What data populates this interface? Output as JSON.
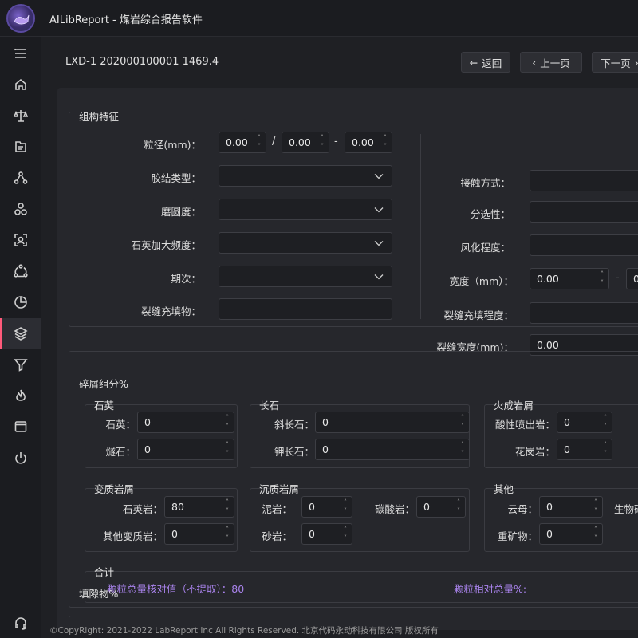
{
  "app": {
    "title": "AILibReport - 煤岩综合报告软件"
  },
  "header": {
    "record_id": "LXD-1 202000100001 1469.4",
    "back_label": "返回",
    "prev_label": "上一页",
    "next_label": "下一页"
  },
  "sidebar": {
    "items": [
      {
        "icon": "menu-icon"
      },
      {
        "icon": "home-icon"
      },
      {
        "icon": "scale-icon"
      },
      {
        "icon": "folder-tree-icon"
      },
      {
        "icon": "network-icon"
      },
      {
        "icon": "circles-icon"
      },
      {
        "icon": "scan-face-icon"
      },
      {
        "icon": "cycle-icon"
      },
      {
        "icon": "pie-chart-icon"
      },
      {
        "icon": "layers-icon"
      },
      {
        "icon": "filter-icon"
      },
      {
        "icon": "flame-icon"
      },
      {
        "icon": "window-icon"
      },
      {
        "icon": "power-icon"
      },
      {
        "icon": "headset-icon"
      }
    ],
    "active_index": 9
  },
  "structure": {
    "title": "组构特征",
    "grain_size_label": "粒径(mm)：",
    "grain_size_1": "0.00",
    "grain_size_sep1": "/",
    "grain_size_2": "0.00",
    "grain_size_sep2": "-",
    "grain_size_3": "0.00",
    "cement_type_label": "胶结类型：",
    "roundness_label": "磨圆度：",
    "quartz_overgrowth_label": "石英加大频度：",
    "stage_label": "期次：",
    "fracture_fill_label": "裂缝充填物：",
    "contact_label": "接触方式：",
    "sorting_label": "分选性：",
    "weathering_label": "风化程度：",
    "width_label": "宽度（mm）：",
    "width_value": "0.00",
    "width_sep": "-",
    "width_value2": "0",
    "fracture_fill_degree_label": "裂缝充填程度：",
    "fracture_width_label": "裂缝宽度(mm)：",
    "fracture_width_value": "0.00"
  },
  "debris": {
    "title": "碎屑组分%",
    "quartz": {
      "title": "石英",
      "quartz_label": "石英：",
      "quartz_value": "0",
      "chert_label": "燧石：",
      "chert_value": "0"
    },
    "feldspar": {
      "title": "长石",
      "plagioclase_label": "斜长石：",
      "plagioclase_value": "0",
      "kfeldspar_label": "钾长石：",
      "kfeldspar_value": "0"
    },
    "igneous": {
      "title": "火成岩屑",
      "acid_volcanic_label": "酸性喷出岩：",
      "acid_volcanic_value": "0",
      "granite_label": "花岗岩：",
      "granite_value": "0"
    },
    "metamorphic": {
      "title": "变质岩屑",
      "quartzite_label": "石英岩：",
      "quartzite_value": "80",
      "other_label": "其他变质岩：",
      "other_value": "0"
    },
    "sedimentary": {
      "title": "沉质岩屑",
      "mudstone_label": "泥岩：",
      "mudstone_value": "0",
      "carbonate_label": "碳酸岩：",
      "carbonate_value": "0",
      "sandstone_label": "砂岩：",
      "sandstone_value": "0"
    },
    "other": {
      "title": "其他",
      "mica_label": "云母：",
      "mica_value": "0",
      "bio_label": "生物碎",
      "heavy_label": "重矿物：",
      "heavy_value": "0"
    },
    "total": {
      "title": "合计",
      "check_value_text": "颗粒总量核对值（不提取）：80",
      "relative_total_text": "颗粒相对总量%:"
    }
  },
  "interstitial": {
    "title": "填隙物%"
  },
  "footer": {
    "copyright": "©CopyRight: 2021-2022 LabReport Inc All Rights Reserved. 北京代码永动科技有限公司 版权所有"
  },
  "colors": {
    "accent": "#ff5a7a",
    "purple_text": "#a983ec",
    "background": "#1f2024"
  }
}
